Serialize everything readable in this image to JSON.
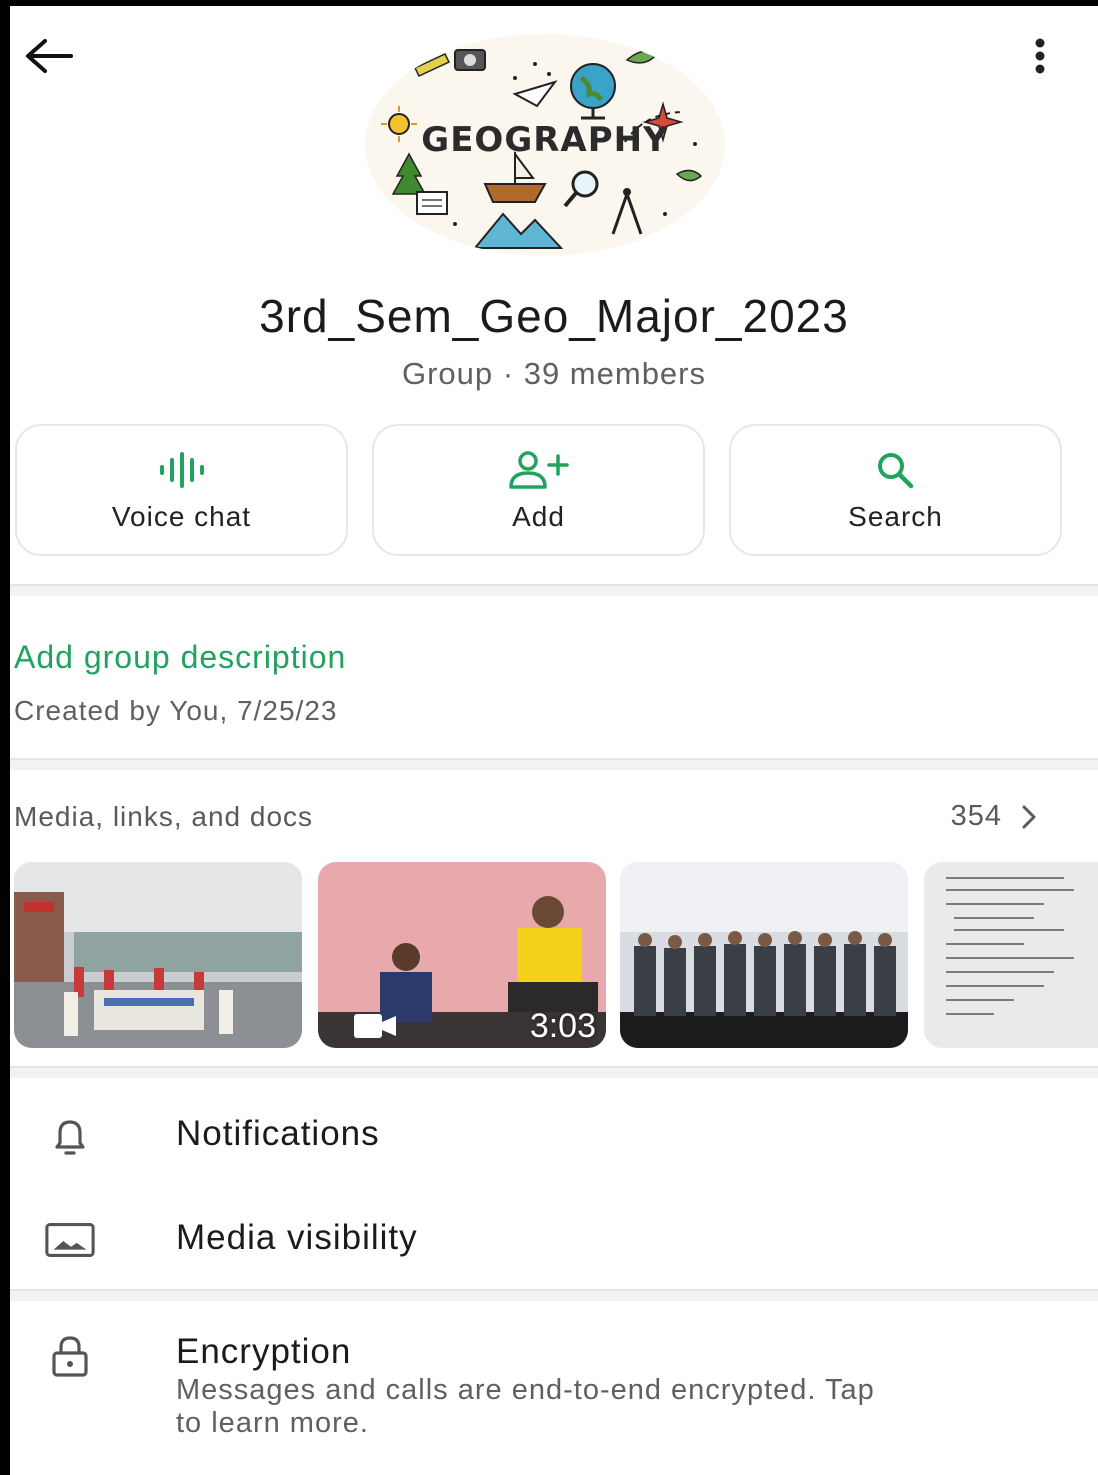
{
  "header": {
    "back_icon": "arrow-left-icon",
    "more_icon": "more-vertical-icon"
  },
  "avatar": {
    "title": "GEOGRAPHY"
  },
  "group": {
    "name": "3rd_Sem_Geo_Major_2023",
    "subtitle": "Group · 39 members"
  },
  "actions": [
    {
      "label": "Voice chat",
      "icon": "voice-wave-icon"
    },
    {
      "label": "Add",
      "icon": "add-person-icon"
    },
    {
      "label": "Search",
      "icon": "search-icon"
    }
  ],
  "description": {
    "link": "Add group description",
    "created": "Created by You, 7/25/23"
  },
  "media": {
    "title": "Media, links, and docs",
    "count": "354",
    "items": [
      {
        "kind": "photo",
        "subject": "street procession"
      },
      {
        "kind": "video",
        "duration": "3:03"
      },
      {
        "kind": "photo",
        "subject": "group on stage"
      },
      {
        "kind": "document"
      }
    ]
  },
  "settings": {
    "notifications": "Notifications",
    "media_visibility": "Media visibility",
    "encryption": "Encryption",
    "encryption_sub": "Messages and calls are end-to-end encrypted. Tap to learn more."
  },
  "colors": {
    "accent": "#21a35f",
    "divider": "#f1f2f2"
  }
}
